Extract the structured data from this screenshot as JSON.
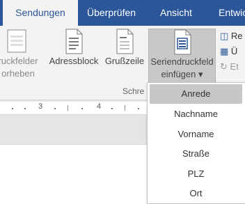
{
  "tabs": {
    "sendungen": "Sendungen",
    "ueberpruefen": "Überprüfen",
    "ansicht": "Ansicht",
    "entw": "Entwic"
  },
  "ribbon": {
    "hervorheben_line1": "ruckfelder",
    "hervorheben_line2": "orheben",
    "adressblock": "Adressblock",
    "grusszeile": "Grußzeile",
    "serien_line1": "Seriendruckfeld",
    "serien_line2": "einfügen ▾",
    "small1": "Re",
    "small2": "Ü",
    "small3": "Et",
    "group_label": "Schre"
  },
  "ruler": {
    "n3": "3",
    "n4": "4"
  },
  "dropdown": {
    "items": [
      "Anrede",
      "Nachname",
      "Vorname",
      "Straße",
      "PLZ",
      "Ort"
    ],
    "selected_index": 0
  },
  "colors": {
    "accent": "#2b579a",
    "ribbon_bg": "#f3f3f3",
    "selected_bg": "#c7c7c7"
  }
}
